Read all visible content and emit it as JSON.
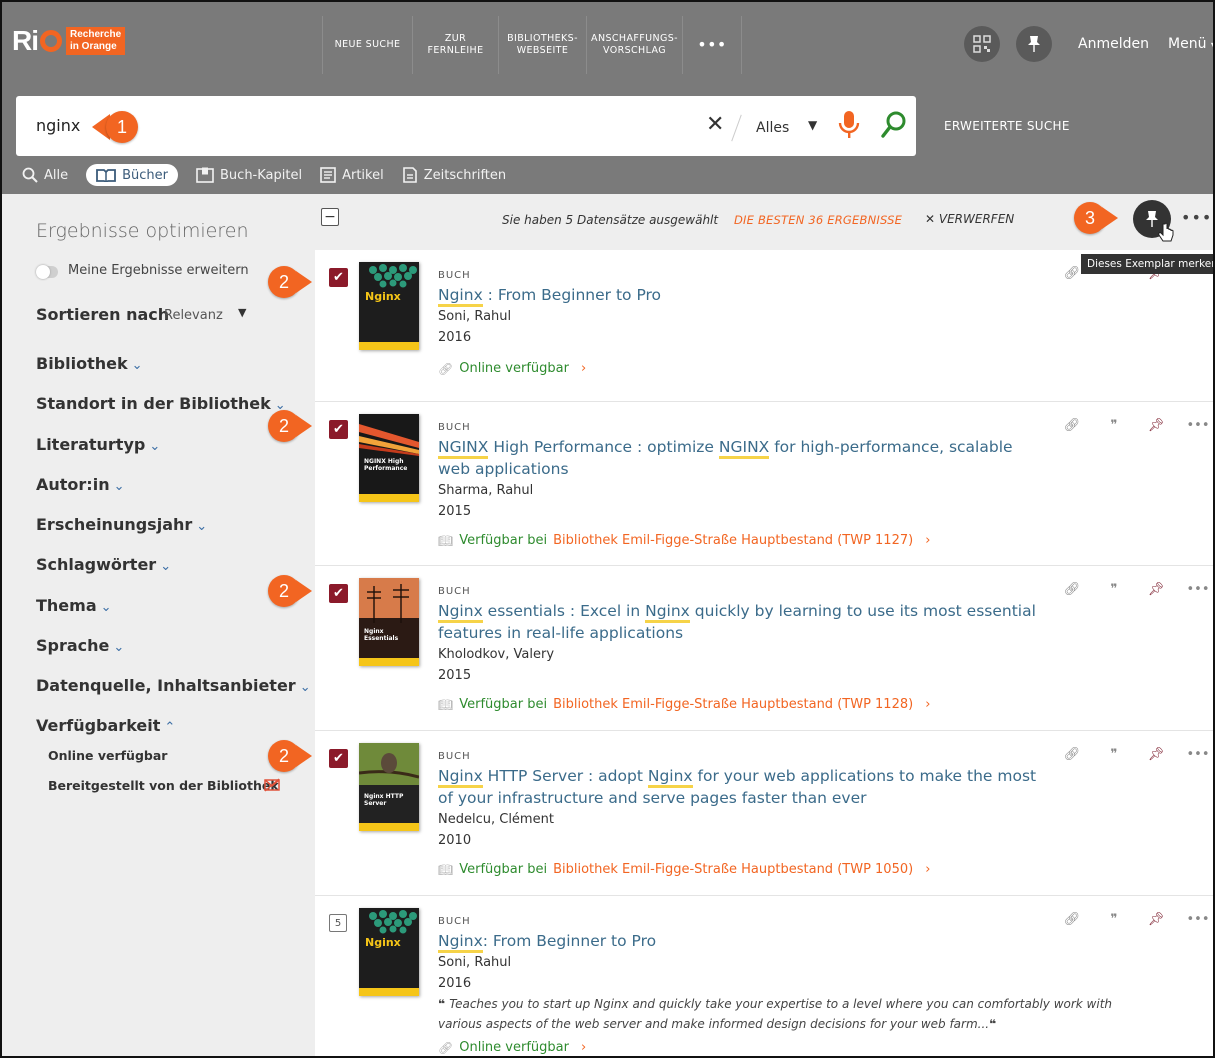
{
  "app": {
    "logo_mark": "Ri",
    "logo_text_line1": "Recherche",
    "logo_text_line2": "in Orange"
  },
  "nav": {
    "items": [
      {
        "label": "NEUE SUCHE"
      },
      {
        "label": "ZUR\nFERNLEIHE"
      },
      {
        "label": "BIBLIOTHEKS-\nWEBSEITE"
      },
      {
        "label": "ANSCHAFFUNGS-\nVORSCHLAG"
      },
      {
        "label": "•••"
      }
    ],
    "login": "Anmelden",
    "menu": "Menü",
    "qr_icon": "qr-code-icon",
    "pin_icon": "pushpin-icon"
  },
  "search": {
    "value": "nginx",
    "scope": "Alles",
    "advanced": "ERWEITERTE SUCHE"
  },
  "type_tabs": [
    {
      "label": "Alle",
      "icon": "search-icon"
    },
    {
      "label": "Bücher",
      "icon": "book-icon"
    },
    {
      "label": "Buch-Kapitel",
      "icon": "book-chapter-icon"
    },
    {
      "label": "Artikel",
      "icon": "article-icon"
    },
    {
      "label": "Zeitschriften",
      "icon": "journal-icon"
    }
  ],
  "sidebar": {
    "title": "Ergebnisse optimieren",
    "expand_toggle": "Meine Ergebnisse erweitern",
    "sort_label": "Sortieren nach",
    "sort_value": "Relevanz",
    "facets": [
      "Bibliothek",
      "Standort in der Bibliothek",
      "Literaturtyp",
      "Autor:in",
      "Erscheinungsjahr",
      "Schlagwörter",
      "Thema",
      "Sprache",
      "Datenquelle, Inhaltsanbieter",
      "Verfügbarkeit"
    ],
    "availability_options": [
      "Online verfügbar",
      "Bereitgestellt von der Bibliothek"
    ]
  },
  "results_header": {
    "selected_text": "Sie haben 5 Datensätze ausgewählt",
    "best_text": "DIE BESTEN 36 ERGEBNISSE",
    "discard": "VERWERFEN",
    "tooltip": "Dieses Exemplar merken",
    "more": "•••"
  },
  "results": [
    {
      "type": "BUCH",
      "title_hl": "Nginx",
      "title_rest": " : From Beginner to Pro",
      "author": "Soni, Rahul",
      "year": "2016",
      "avail_prefix": "Online verfügbar",
      "avail_loc": "",
      "selected": true,
      "cover": "nginx-green"
    },
    {
      "type": "BUCH",
      "title_hl": "NGINX",
      "title_rest_a": " High Performance : optimize ",
      "title_hl2": "NGINX",
      "title_rest_b": " for high-performance, scalable web applications",
      "author": "Sharma, Rahul",
      "year": "2015",
      "avail_prefix": "Verfügbar bei",
      "avail_loc": "Bibliothek Emil-Figge-Straße  Hauptbestand (TWP 1127)",
      "selected": true,
      "cover": "nginx-high-performance"
    },
    {
      "type": "BUCH",
      "title_hl": "Nginx",
      "title_rest_a": " essentials : Excel in ",
      "title_hl2": "Nginx",
      "title_rest_b": " quickly by learning to use its most essential features in real-life applications",
      "author": "Kholodkov, Valery",
      "year": "2015",
      "avail_prefix": "Verfügbar bei",
      "avail_loc": "Bibliothek Emil-Figge-Straße  Hauptbestand (TWP 1128)",
      "selected": true,
      "cover": "nginx-essentials"
    },
    {
      "type": "BUCH",
      "title_hl": "Nginx",
      "title_rest_a": " HTTP Server : adopt ",
      "title_hl2": "Nginx",
      "title_rest_b": " for your web applications to make the most of your infrastructure and serve pages faster than ever",
      "author": "Nedelcu, Clément",
      "year": "2010",
      "avail_prefix": "Verfügbar bei",
      "avail_loc": "Bibliothek Emil-Figge-Straße  Hauptbestand (TWP 1050)",
      "selected": true,
      "cover": "nginx-http-server"
    },
    {
      "type": "BUCH",
      "index": "5",
      "title_hl": "Nginx",
      "title_rest": ": From Beginner to Pro",
      "author": "Soni, Rahul",
      "year": "2016",
      "description": "Teaches you to start up Nginx and quickly take your expertise to a level where you can comfortably work with various aspects of the web server and make informed design decisions for your web farm...",
      "avail_prefix": "Online verfügbar",
      "selected": false,
      "cover": "nginx-green"
    }
  ],
  "covers": {
    "nginx_word": "Nginx",
    "nginx_hp": "NGINX High Performance",
    "nginx_ess": "Nginx Essentials",
    "nginx_http": "Nginx HTTP Server"
  },
  "callouts": [
    "1",
    "2",
    "3"
  ],
  "colors": {
    "accent": "#f26522",
    "topbar": "#7a7a7a",
    "checkbox": "#8b1a2a",
    "link": "#3b6b8a",
    "available": "#2e8b2e"
  }
}
